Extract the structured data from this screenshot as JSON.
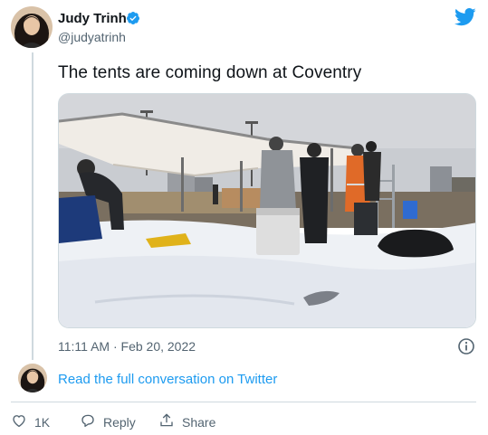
{
  "author": {
    "name": "Judy Trinh",
    "handle": "@judyatrinh",
    "verified": true
  },
  "tweet": {
    "text": "The tents are coming down at Coventry",
    "timestamp": "11:11 AM · Feb 20, 2022"
  },
  "read_more_label": "Read the full conversation on Twitter",
  "actions": {
    "like_count": "1K",
    "reply_label": "Reply",
    "share_label": "Share"
  },
  "icons": {
    "brand": "twitter-bird-icon",
    "verified": "verified-badge-icon",
    "info": "info-icon",
    "like": "heart-icon",
    "reply": "reply-bubble-icon",
    "share": "share-icon"
  },
  "colors": {
    "accent": "#1d9bf0",
    "text": "#0f1419",
    "muted": "#536471",
    "border": "#cfd9de"
  }
}
